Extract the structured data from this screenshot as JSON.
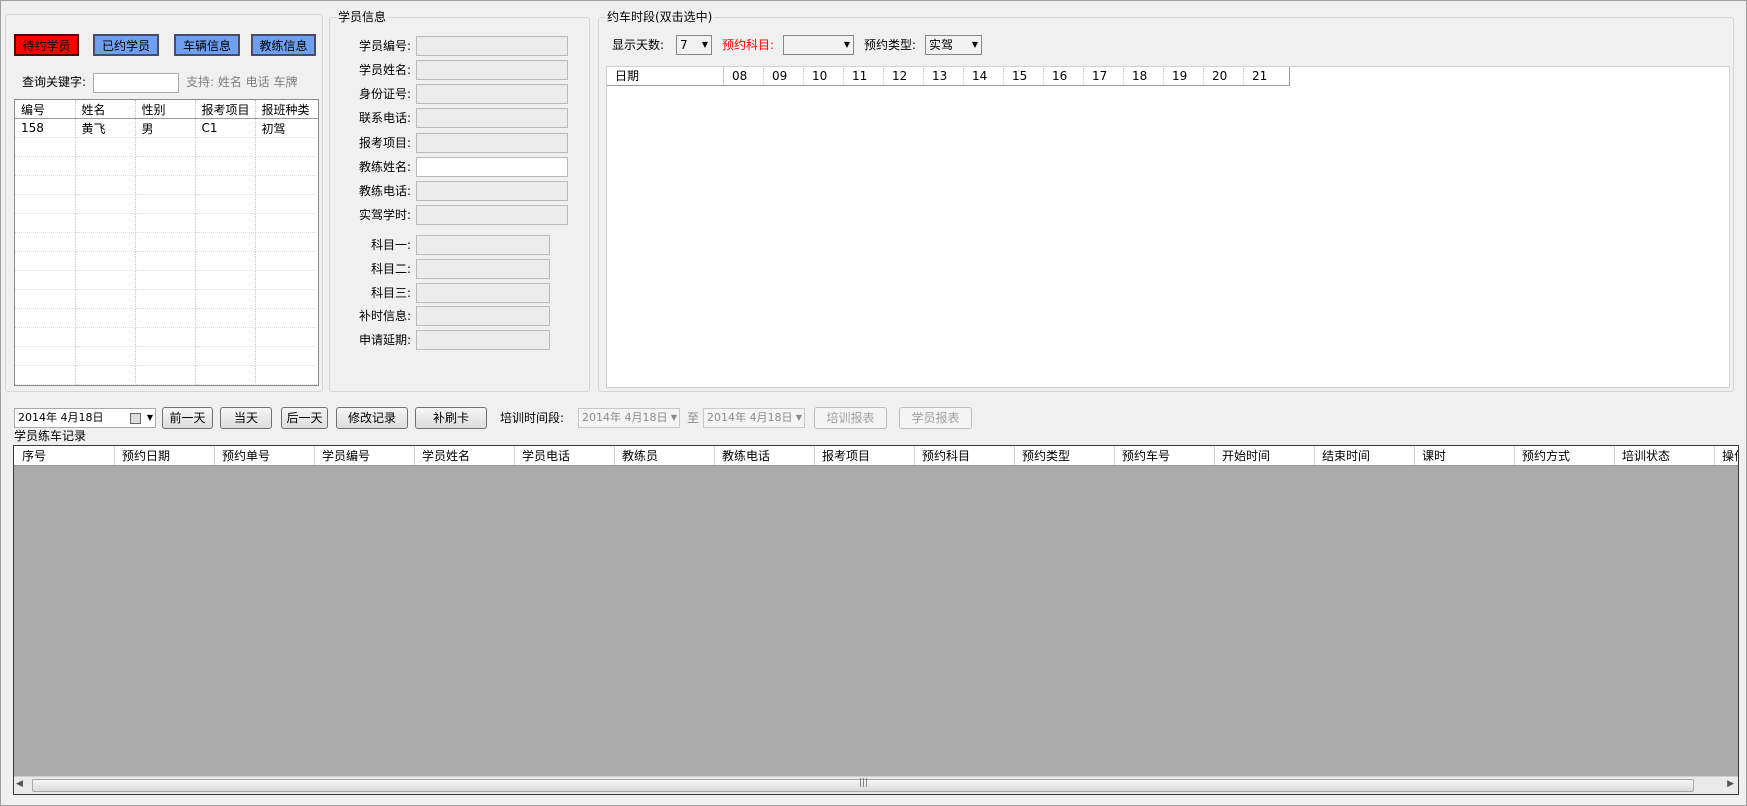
{
  "tabs": {
    "pending": "待约学员",
    "booked": "已约学员",
    "vehicle": "车辆信息",
    "coach": "教练信息"
  },
  "search": {
    "label": "查询关键字:",
    "value": "",
    "hint": "支持: 姓名 电话 车牌"
  },
  "student_list": {
    "columns": [
      "编号",
      "姓名",
      "性别",
      "报考项目",
      "报班种类"
    ],
    "rows": [
      [
        "158",
        "黄飞",
        "男",
        "C1",
        "初驾"
      ]
    ]
  },
  "student_info": {
    "title": "学员信息",
    "fields": [
      {
        "label": "学员编号:",
        "value": ""
      },
      {
        "label": "学员姓名:",
        "value": ""
      },
      {
        "label": "身份证号:",
        "value": ""
      },
      {
        "label": "联系电话:",
        "value": ""
      },
      {
        "label": "报考项目:",
        "value": ""
      },
      {
        "label": "教练姓名:",
        "value": ""
      },
      {
        "label": "教练电话:",
        "value": ""
      },
      {
        "label": "实驾学时:",
        "value": ""
      },
      {
        "label": "科目一:",
        "value": ""
      },
      {
        "label": "科目二:",
        "value": ""
      },
      {
        "label": "科目三:",
        "value": ""
      },
      {
        "label": "补时信息:",
        "value": ""
      },
      {
        "label": "申请延期:",
        "value": ""
      }
    ]
  },
  "booking": {
    "title": "约车时段(双击选中)",
    "days_label": "显示天数:",
    "days_value": "7",
    "subject_label": "预约科目:",
    "subject_value": "",
    "type_label": "预约类型:",
    "type_value": "实驾",
    "date_header": "日期",
    "hours": [
      "08",
      "09",
      "10",
      "11",
      "12",
      "13",
      "14",
      "15",
      "16",
      "17",
      "18",
      "19",
      "20",
      "21"
    ]
  },
  "toolbar": {
    "date_value": "2014年  4月18日",
    "prev_day": "前一天",
    "today": "当天",
    "next_day": "后一天",
    "modify_record": "修改记录",
    "recard": "补刷卡",
    "period_label": "培训时间段:",
    "period_from": "2014年  4月18日",
    "to_label": "至",
    "period_to": "2014年  4月18日",
    "training_report": "培训报表",
    "student_report": "学员报表"
  },
  "records": {
    "title": "学员练车记录",
    "columns": [
      "序号",
      "预约日期",
      "预约单号",
      "学员编号",
      "学员姓名",
      "学员电话",
      "教练员",
      "教练电话",
      "报考项目",
      "预约科目",
      "预约类型",
      "预约车号",
      "开始时间",
      "结束时间",
      "课时",
      "预约方式",
      "培训状态",
      "操作员"
    ]
  },
  "colors": {
    "tab_active": "#ff0000",
    "tab_inactive": "#6fa0f0",
    "subject_label": "#ff0000",
    "grid_empty": "#ababab"
  }
}
